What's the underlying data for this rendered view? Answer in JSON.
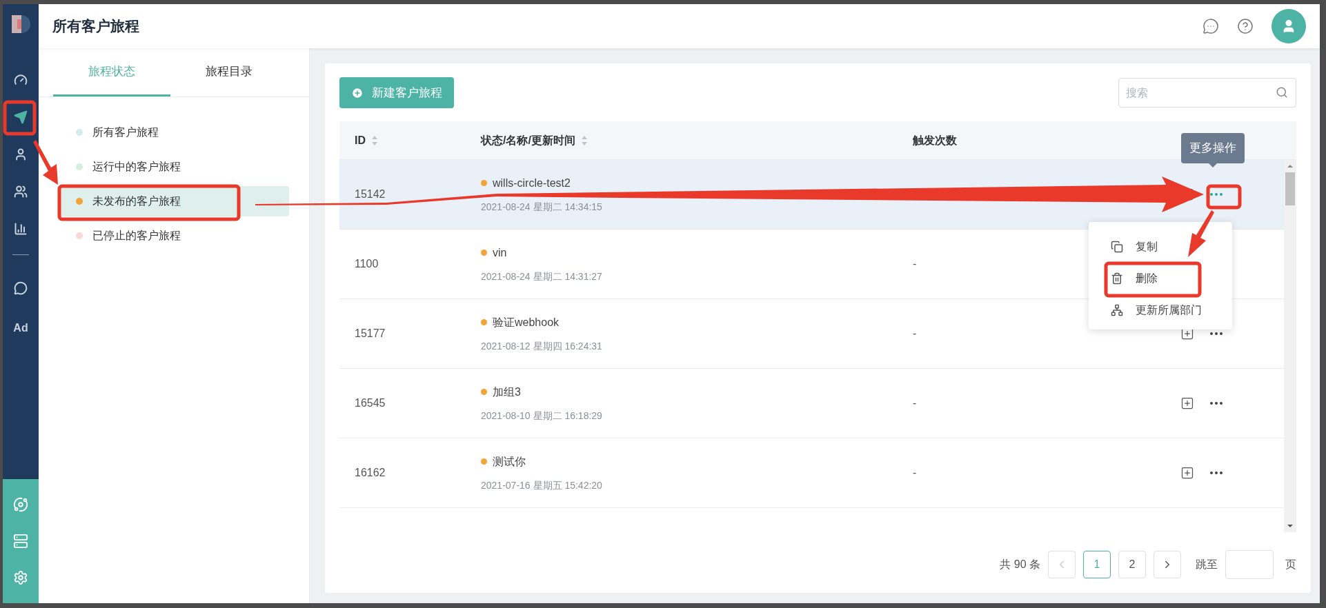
{
  "nav": {
    "items": [
      {
        "selected": false
      },
      {
        "selected": true
      },
      {
        "selected": false
      },
      {
        "selected": false
      },
      {
        "selected": false
      },
      {
        "selected": false
      }
    ],
    "ad_label": "Ad"
  },
  "header": {
    "title": "所有客户旅程"
  },
  "filter_panel": {
    "tabs": [
      {
        "label": "旅程状态",
        "selected": true
      },
      {
        "label": "旅程目录",
        "selected": false
      }
    ],
    "items": [
      {
        "label": "所有客户旅程",
        "color": "#d3ecea",
        "selected": false
      },
      {
        "label": "运行中的客户旅程",
        "color": "#d5eedf",
        "selected": false
      },
      {
        "label": "未发布的客户旅程",
        "color": "#f2a33a",
        "selected": true
      },
      {
        "label": "已停止的客户旅程",
        "color": "#f8d9d3",
        "selected": false
      }
    ]
  },
  "toolbar": {
    "new_button": "新建客户旅程",
    "search": {
      "placeholder": "搜索"
    }
  },
  "table": {
    "columns": [
      "ID",
      "状态/名称/更新时间",
      "触发次数"
    ],
    "rows": [
      {
        "id": "15142",
        "name": "wills-circle-test2",
        "color": "#f2a33a",
        "time": "2021-08-24 星期二 14:34:15",
        "hovered": true,
        "menu_open": true,
        "actions_visible": true
      },
      {
        "id": "1100",
        "name": "vin",
        "color": "#f2a33a",
        "time": "2021-08-24 星期二 14:31:27",
        "triggers": "-",
        "hovered": false,
        "actions_visible": false
      },
      {
        "id": "15177",
        "name": "验证webhook",
        "color": "#f2a33a",
        "time": "2021-08-12 星期四 16:24:31",
        "triggers": "-",
        "hovered": false,
        "menu_open": false,
        "actions_visible": true
      },
      {
        "id": "16545",
        "name": "加组3",
        "color": "#f2a33a",
        "time": "2021-08-10 星期二 16:18:29",
        "triggers": "-",
        "hovered": false,
        "menu_open": false,
        "actions_visible": true
      },
      {
        "id": "16162",
        "name": "测试你",
        "color": "#f2a33a",
        "time": "2021-07-16 星期五 15:42:20",
        "triggers": "-",
        "hovered": false,
        "menu_open": false,
        "actions_visible": true
      }
    ]
  },
  "tooltip": "更多操作",
  "menu": {
    "items": [
      "复制",
      "删除",
      "更新所属部门"
    ]
  },
  "pagination": {
    "total": "共 90 条",
    "prev_disabled": true,
    "pages": [
      {
        "label": "1",
        "selected": true
      },
      {
        "label": "2",
        "selected": false
      }
    ],
    "jump_label": "跳至",
    "page_suffix": "页"
  }
}
